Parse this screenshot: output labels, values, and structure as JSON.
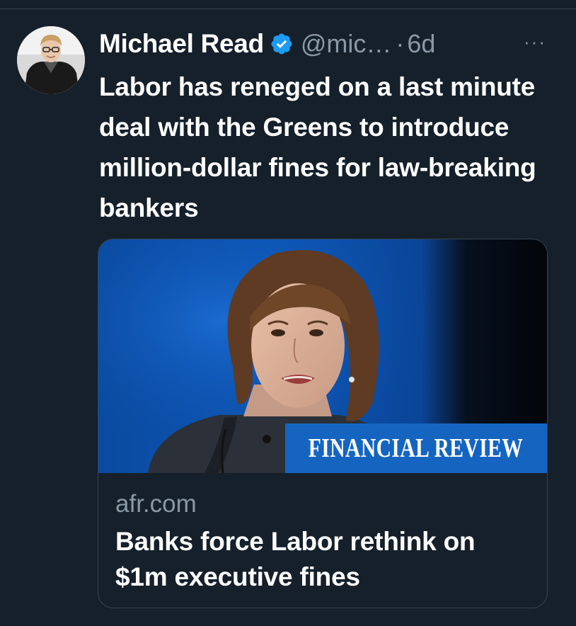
{
  "tweet": {
    "author_name": "Michael Read",
    "handle": "@mic…",
    "separator": "·",
    "timestamp": "6d",
    "more_icon": "ellipsis-icon",
    "verified_icon": "verified-badge-icon",
    "text": "Labor has reneged on a last minute deal with the Greens to introduce million-dollar fines for law-breaking bankers"
  },
  "card": {
    "image_banner": "FINANCIAL REVIEW",
    "domain": "afr.com",
    "title": "Banks force Labor rethink on $1m executive fines"
  },
  "colors": {
    "background": "#15202b",
    "secondary_text": "#8b98a5",
    "verified_blue": "#1d9bf0",
    "banner_blue": "#1565c0",
    "border": "#38444d"
  }
}
